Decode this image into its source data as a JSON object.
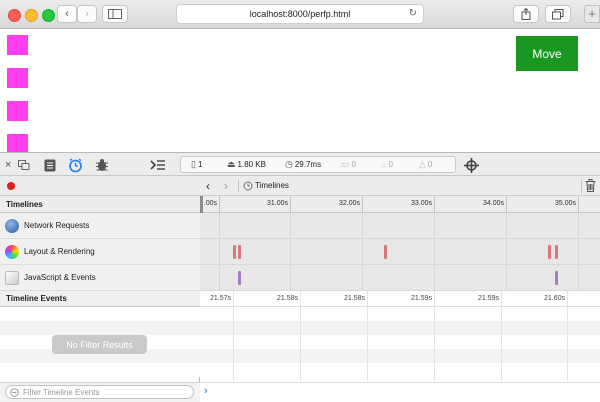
{
  "browser": {
    "url": "localhost:8000/perfp.html",
    "back_icon": "chevron-left-icon",
    "forward_icon": "chevron-right-icon",
    "new_tab_label": "+"
  },
  "page": {
    "move_button": "Move",
    "square_color": "#ff3df0",
    "button_color": "#1a9721"
  },
  "inspector": {
    "stats": {
      "resources": "1",
      "size": "1.80 KB",
      "time": "29.7ms",
      "messages": "0",
      "errors": "0",
      "warnings": "0"
    },
    "navbar": {
      "title": "Timelines"
    },
    "timelines_header": "Timelines",
    "timelines": [
      {
        "label": "Network Requests"
      },
      {
        "label": "Layout & Rendering"
      },
      {
        "label": "JavaScript & Events"
      }
    ],
    "ruler_ticks": [
      ".00s",
      "31.00s",
      "32.00s",
      "33.00s",
      "34.00s",
      "35.00s"
    ],
    "events_header": "Timeline Events",
    "event_ticks": [
      "21.57s",
      "21.58s",
      "21.58s",
      "21.59s",
      "21.59s",
      "21.60s"
    ],
    "no_filter_results": "No Filter Results",
    "filter_placeholder": "Filter Timeline Events",
    "console_prompt": "›",
    "colors": {
      "layout_mark": "#d9777a",
      "script_mark": "#a67bc8",
      "record": "#e0201b"
    }
  }
}
